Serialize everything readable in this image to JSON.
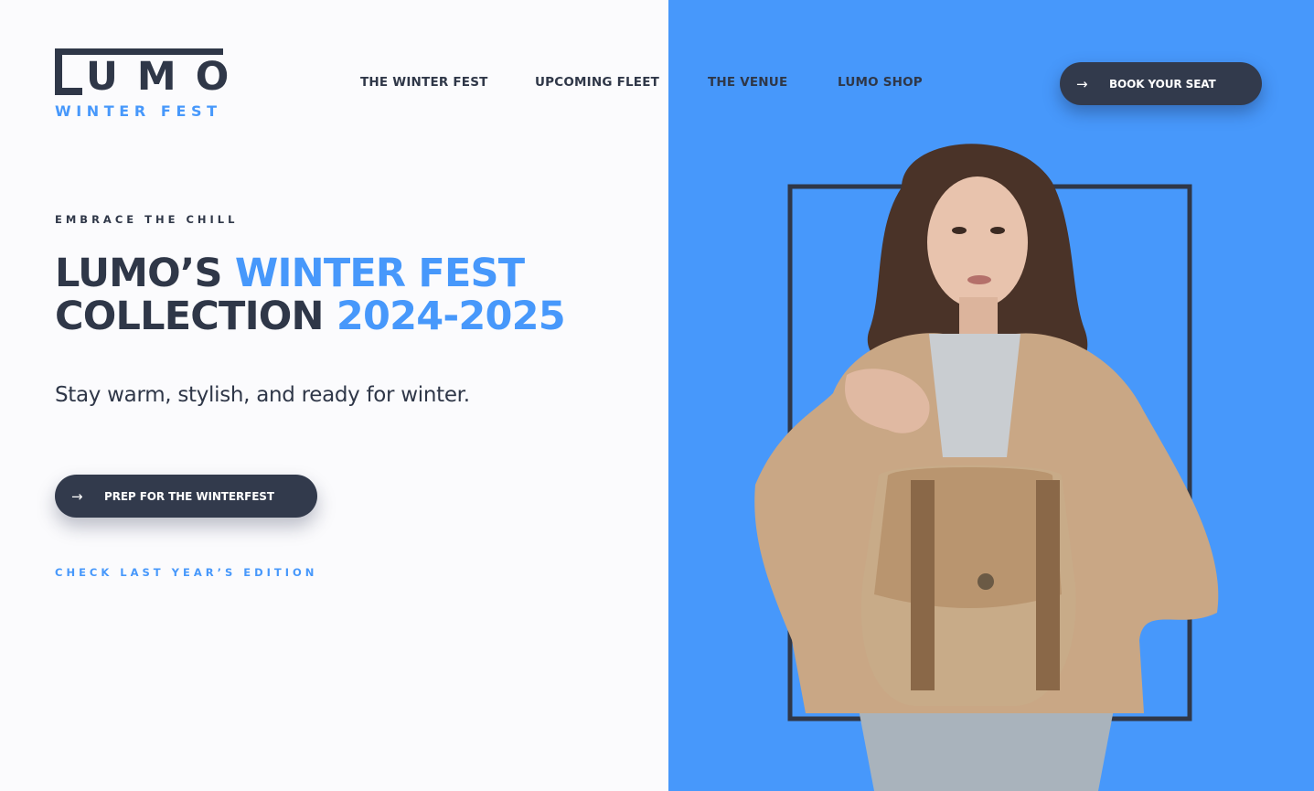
{
  "logo": {
    "word": "LUMO",
    "letters": "UMO",
    "subtitle": "WINTER FEST"
  },
  "nav": {
    "items": [
      {
        "label": "THE WINTER FEST"
      },
      {
        "label": "UPCOMING FLEET"
      },
      {
        "label": "THE VENUE"
      },
      {
        "label": "LUMO SHOP"
      }
    ],
    "book_button": "BOOK YOUR SEAT"
  },
  "hero": {
    "eyebrow": "EMBRACE THE CHILL",
    "headline_line1_dark": "LUMO’S",
    "headline_line1_accent": "WINTER FEST",
    "headline_line2_dark": "COLLECTION",
    "headline_line2_accent": "2024-2025",
    "subline": "Stay warm, stylish, and ready for winter.",
    "cta_button": "PREP FOR THE WINTERFEST",
    "edition_link": "CHECK LAST YEAR’S EDITION"
  },
  "icons": {
    "button_arrow": "arrow-right-icon"
  },
  "colors": {
    "accent": "#4798fb",
    "dark": "#2f3748",
    "button": "#323a4c",
    "background": "#fbfbfd"
  }
}
